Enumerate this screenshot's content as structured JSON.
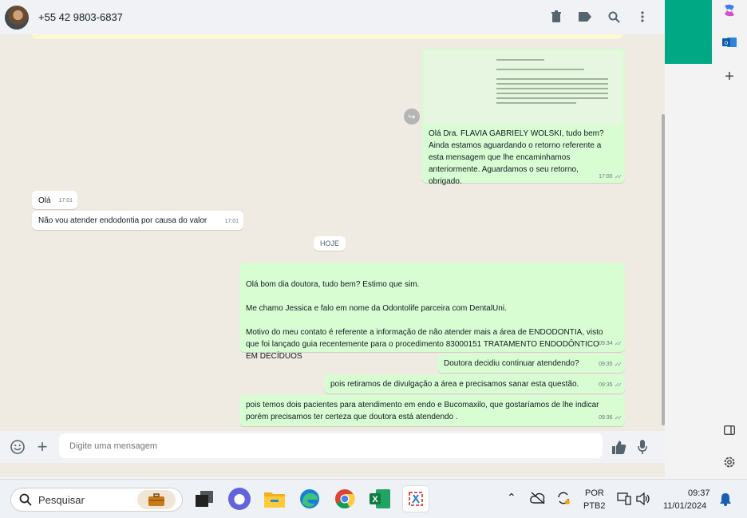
{
  "header": {
    "contact": "+55 42 9803-6837",
    "icons": [
      "trash-icon",
      "label-icon",
      "search-icon",
      "menu-icon"
    ]
  },
  "messages": {
    "forwarded": {
      "text": "Olá Dra. FLAVIA GABRIELY WOLSKI, tudo bem?\nAinda estamos aguardando o retorno referente a esta mensagem que lhe encaminhamos anteriormente. Aguardamos o seu retorno, obrigado.",
      "time": "17:00"
    },
    "in1": {
      "text": "Olá",
      "time": "17:01"
    },
    "in2": {
      "text": "Não vou atender endodontia por causa do valor",
      "time": "17:01"
    },
    "date_divider": "HOJE",
    "out1": {
      "text": "Olá bom dia doutora, tudo bem? Estimo que sim.\n\nMe chamo Jessica e falo em nome da Odontolife parceira com DentalUni.\n\nMotivo do meu contato é referente a informação de não atender mais a área de ENDODONTIA, visto que foi lançado guia recentemente para o procedimento 83000151    TRATAMENTO ENDODÔNTICO EM DECÍDUOS",
      "time": "09:34"
    },
    "out2": {
      "text": "Doutora decidiu continuar atendendo?",
      "time": "09:35"
    },
    "out3": {
      "text": "pois retiramos de divulgação a área e precisamos sanar esta questão.",
      "time": "09:35"
    },
    "out4": {
      "text": "pois temos dois pacientes para atendimento em endo e Bucomaxilo, que gostaríamos de lhe indicar porém precisamos ter certeza que doutora está atendendo .",
      "time": "09:36"
    }
  },
  "composer": {
    "placeholder": "Digite uma mensagem"
  },
  "taskbar": {
    "search_label": "Pesquisar",
    "lang_top": "POR",
    "lang_bottom": "PTB2",
    "time": "09:37",
    "date": "11/01/2024"
  },
  "colors": {
    "outgoing_bubble": "#d9fdd3",
    "incoming_bubble": "#ffffff",
    "accent": "#00a884",
    "chat_bg": "#efeae2"
  }
}
